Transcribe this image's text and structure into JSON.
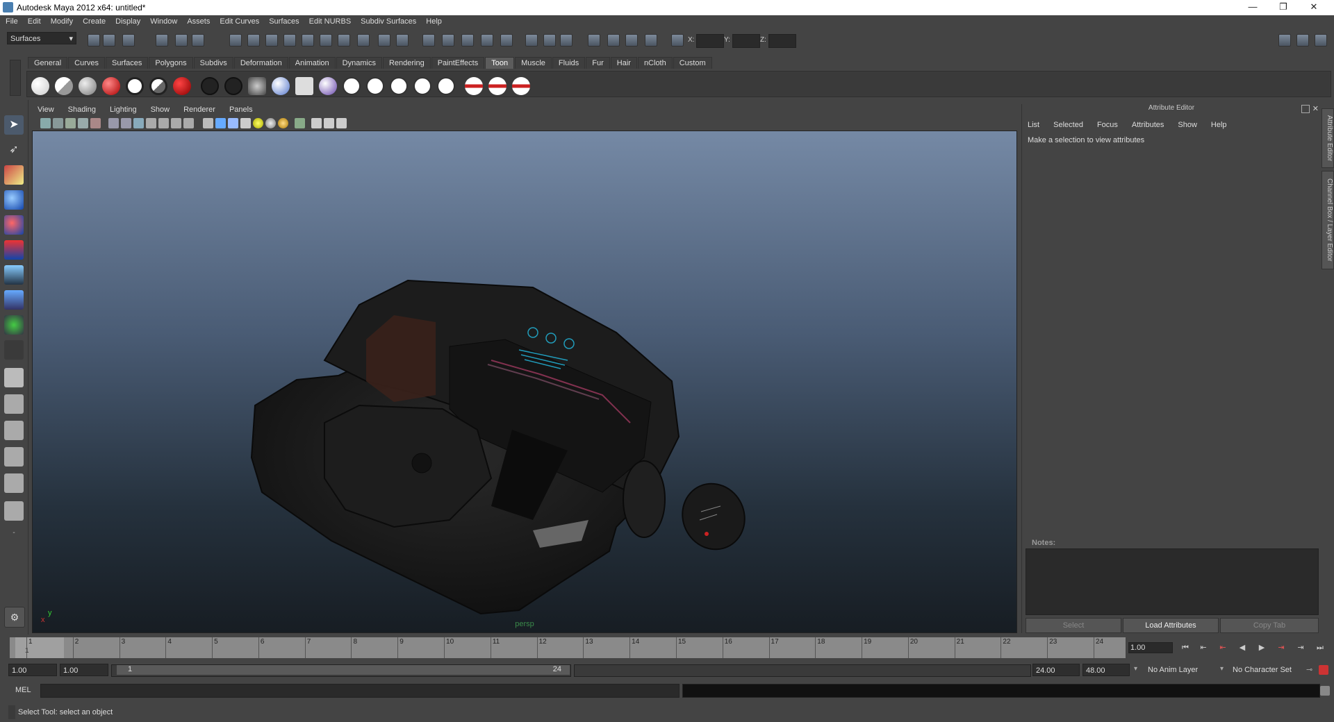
{
  "title": "Autodesk Maya 2012 x64: untitled*",
  "window_controls": [
    "—",
    "❐",
    "✕"
  ],
  "menu": [
    "File",
    "Edit",
    "Modify",
    "Create",
    "Display",
    "Window",
    "Assets",
    "Edit Curves",
    "Surfaces",
    "Edit NURBS",
    "Subdiv Surfaces",
    "Help"
  ],
  "status": {
    "mode": "Surfaces",
    "coord_labels": [
      "X:",
      "Y:",
      "Z:"
    ]
  },
  "shelf": {
    "tabs": [
      "General",
      "Curves",
      "Surfaces",
      "Polygons",
      "Subdivs",
      "Deformation",
      "Animation",
      "Dynamics",
      "Rendering",
      "PaintEffects",
      "Toon",
      "Muscle",
      "Fluids",
      "Fur",
      "Hair",
      "nCloth",
      "Custom"
    ],
    "active": "Toon"
  },
  "viewport": {
    "menu": [
      "View",
      "Shading",
      "Lighting",
      "Show",
      "Renderer",
      "Panels"
    ],
    "camera": "persp",
    "axis_x": "x",
    "axis_y": "y"
  },
  "attribute_editor": {
    "title": "Attribute Editor",
    "menu": [
      "List",
      "Selected",
      "Focus",
      "Attributes",
      "Show",
      "Help"
    ],
    "message": "Make a selection to view attributes",
    "notes_label": "Notes:",
    "buttons": [
      "Select",
      "Load Attributes",
      "Copy Tab"
    ]
  },
  "side_tabs": [
    "Attribute Editor",
    "Channel Box / Layer Editor"
  ],
  "timeline": {
    "frames": [
      "1",
      "2",
      "3",
      "4",
      "5",
      "6",
      "7",
      "8",
      "9",
      "10",
      "11",
      "12",
      "13",
      "14",
      "15",
      "16",
      "17",
      "18",
      "19",
      "20",
      "21",
      "22",
      "23",
      "24"
    ],
    "current_frame_display": "1",
    "current_time": "1.00"
  },
  "range": {
    "start": "1.00",
    "start2": "1.00",
    "slider_start": "1",
    "slider_end": "24",
    "end": "24.00",
    "end2": "48.00",
    "anim_layer": "No Anim Layer",
    "char_set": "No Character Set"
  },
  "command": {
    "label": "MEL"
  },
  "help_line": "Select Tool: select an object"
}
